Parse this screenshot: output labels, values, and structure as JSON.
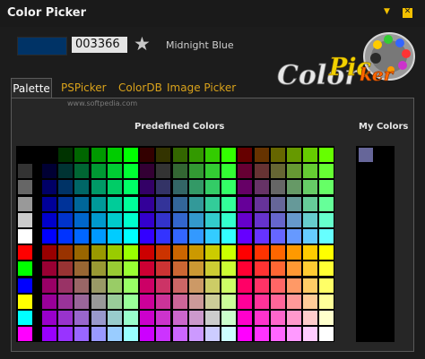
{
  "window": {
    "title": "Color Picker",
    "minimize_glyph": "▼",
    "close_glyph": "✕"
  },
  "current": {
    "hex": "003366",
    "name": "Midnight Blue",
    "swatch_color": "#003366"
  },
  "icons": {
    "favorite": "star-icon"
  },
  "logo": {
    "text": "ColorPicker",
    "alt": "Color Picker logo with paint palette"
  },
  "tabs": [
    "Palette",
    "PSPicker",
    "ColorDB",
    "Image Picker"
  ],
  "watermark": "www.softpedia.com",
  "labels": {
    "predefined": "Predefined Colors",
    "my_colors": "My Colors"
  },
  "my_colors": [
    "#666699"
  ],
  "gray_column": [
    "#000000",
    "#333333",
    "#666666",
    "#999999",
    "#cccccc",
    "#ffffff",
    "#ff0000",
    "#00ff00",
    "#0000ff",
    "#ffff00",
    "#00ffff",
    "#ff00ff"
  ],
  "palette": {
    "rgb_levels": [
      "00",
      "33",
      "66",
      "99",
      "cc",
      "ff"
    ],
    "layout": "12 rows x 18 columns web-safe cube; top half red 00-66, bottom half red 99-ff"
  },
  "accent": "#f3c000"
}
